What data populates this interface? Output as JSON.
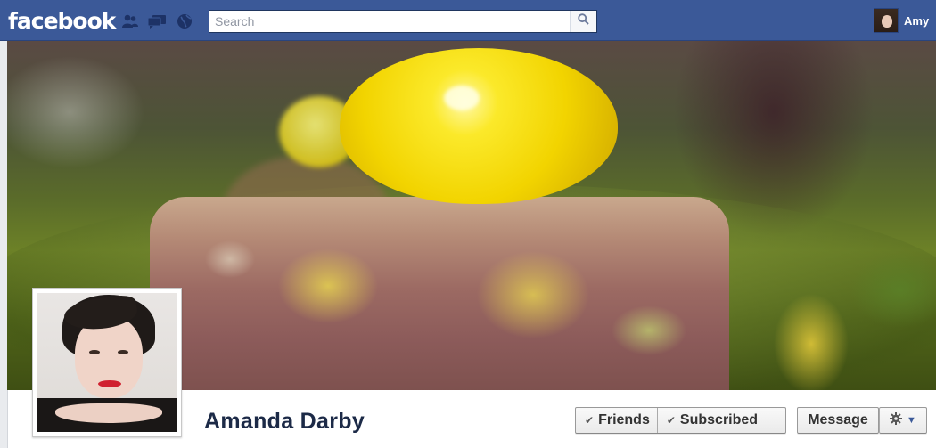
{
  "header": {
    "logo_text": "facebook",
    "search": {
      "placeholder": "Search"
    },
    "user": {
      "name": "Amy"
    },
    "brand_color": "#3b5998"
  },
  "icons": {
    "friend_requests": "friend-requests-icon",
    "messages": "messages-icon",
    "notifications": "notifications-globe-icon",
    "search": "search-icon",
    "check": "check-icon",
    "gear": "gear-icon",
    "caret": "caret-down-icon"
  },
  "profile": {
    "name": "Amanda Darby"
  },
  "actions": {
    "friends_label": "Friends",
    "subscribed_label": "Subscribed",
    "message_label": "Message"
  }
}
